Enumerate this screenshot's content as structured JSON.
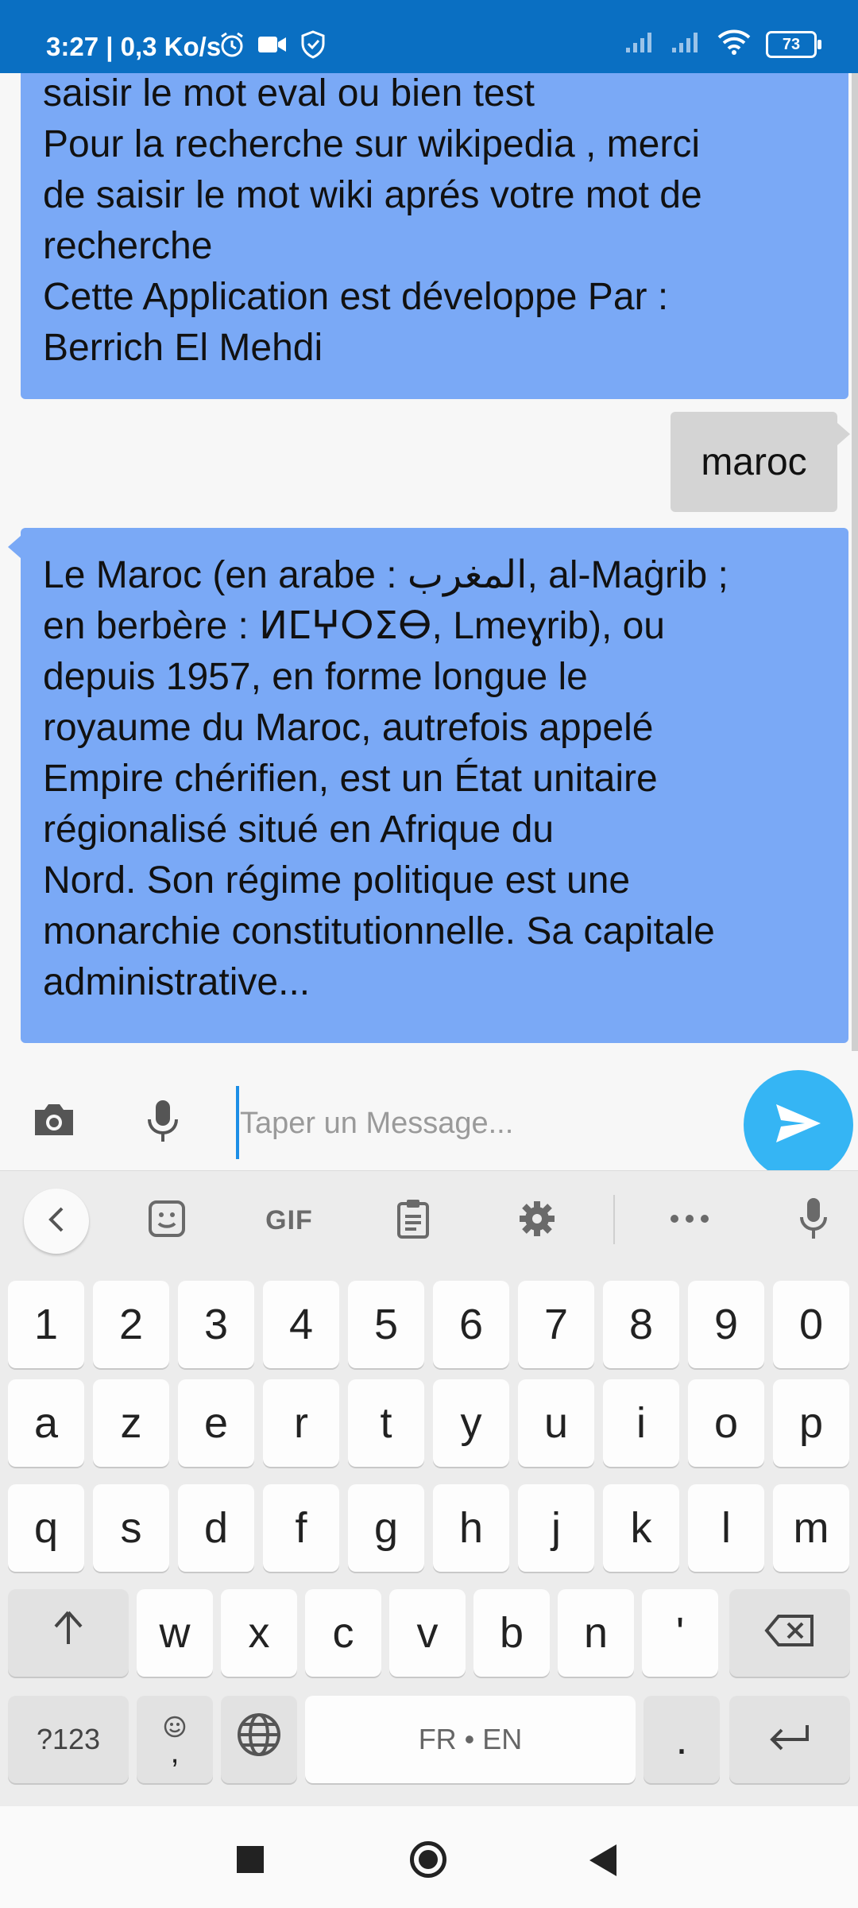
{
  "status_bar": {
    "time": "3:27 | 0,3 Ko/s",
    "battery": "73",
    "icons": [
      "alarm-icon",
      "video-camera-icon",
      "shield-icon",
      "signal-icon",
      "signal-icon",
      "wifi-icon",
      "battery-icon"
    ]
  },
  "chat": {
    "messages": [
      {
        "sender": "bot",
        "lines": [
          "saisir le mot eval ou bien test",
          "Pour la recherche sur wikipedia , merci",
          "de saisir le mot wiki aprés votre mot de",
          "recherche",
          "Cette Application est développe Par :",
          "Berrich El Mehdi"
        ]
      },
      {
        "sender": "user",
        "text": "maroc"
      },
      {
        "sender": "bot",
        "lines": [
          "Le Maroc (en arabe : المغرب, al-Maġrib ;",
          "en berbère : ⵍⵎⵖⵔⵉⴱ, Lmeɣrib), ou",
          "depuis 1957, en forme longue le",
          "royaume du Maroc, autrefois appelé",
          "Empire chérifien, est un État unitaire",
          "régionalisé situé en Afrique du",
          "Nord. Son régime politique est une",
          "monarchie constitutionnelle. Sa capitale",
          "administrative..."
        ]
      }
    ]
  },
  "input": {
    "placeholder": "Taper un Message...",
    "value": ""
  },
  "keyboard": {
    "toolbar": [
      "back-icon",
      "sticker-icon",
      "GIF",
      "clipboard-icon",
      "settings-icon",
      "more-icon",
      "voice-icon"
    ],
    "gif_label": "GIF",
    "row_numbers": [
      "1",
      "2",
      "3",
      "4",
      "5",
      "6",
      "7",
      "8",
      "9",
      "0"
    ],
    "row1": [
      "a",
      "z",
      "e",
      "r",
      "t",
      "y",
      "u",
      "i",
      "o",
      "p"
    ],
    "row2": [
      "q",
      "s",
      "d",
      "f",
      "g",
      "h",
      "j",
      "k",
      "l",
      "m"
    ],
    "row3": [
      "w",
      "x",
      "c",
      "v",
      "b",
      "n",
      "'"
    ],
    "symbols_label": "?123",
    "comma_label": ",",
    "space_label": "FR • EN",
    "period_label": "."
  },
  "colors": {
    "status_bar": "#0a6fc2",
    "bot_bubble": "#7aa9f6",
    "user_bubble": "#d4d4d4",
    "send_button": "#35b5f4"
  }
}
